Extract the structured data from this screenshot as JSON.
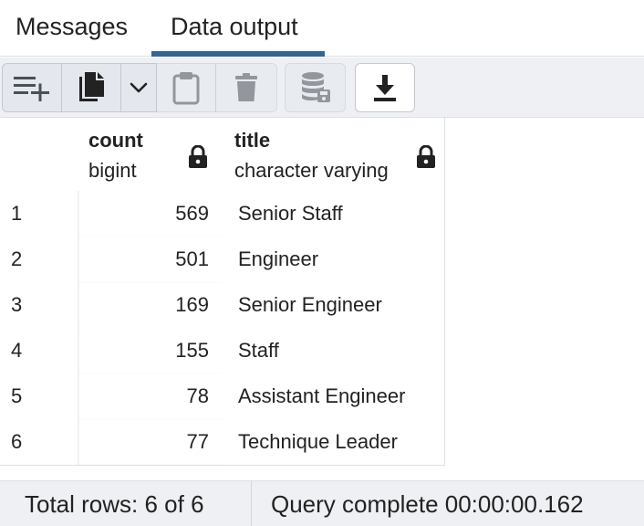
{
  "tabs": {
    "messages": "Messages",
    "data_output": "Data output",
    "active": "Data output"
  },
  "toolbar": {
    "buttons": [
      {
        "icon": "add-row-icon"
      },
      {
        "icon": "copy-icon"
      },
      {
        "icon": "chevron-down-icon"
      },
      {
        "icon": "paste-icon"
      },
      {
        "icon": "delete-icon"
      },
      {
        "icon": "save-data-icon"
      },
      {
        "icon": "download-icon"
      }
    ]
  },
  "grid": {
    "columns": [
      {
        "name": "count",
        "type": "bigint",
        "locked": true
      },
      {
        "name": "title",
        "type": "character varying",
        "locked": true
      }
    ],
    "rows": [
      {
        "num": "1",
        "count": "569",
        "title": "Senior Staff"
      },
      {
        "num": "2",
        "count": "501",
        "title": "Engineer"
      },
      {
        "num": "3",
        "count": "169",
        "title": "Senior Engineer"
      },
      {
        "num": "4",
        "count": "155",
        "title": "Staff"
      },
      {
        "num": "5",
        "count": "78",
        "title": "Assistant Engineer"
      },
      {
        "num": "6",
        "count": "77",
        "title": "Technique Leader"
      }
    ]
  },
  "status": {
    "total_rows": "Total rows: 6 of 6",
    "query": "Query complete 00:00:00.162"
  },
  "colors": {
    "tab_underline": "#326690",
    "toolbar_bg": "#eef0f4",
    "button_bg": "#e4e7ed",
    "grid_border": "#dde0e6"
  }
}
